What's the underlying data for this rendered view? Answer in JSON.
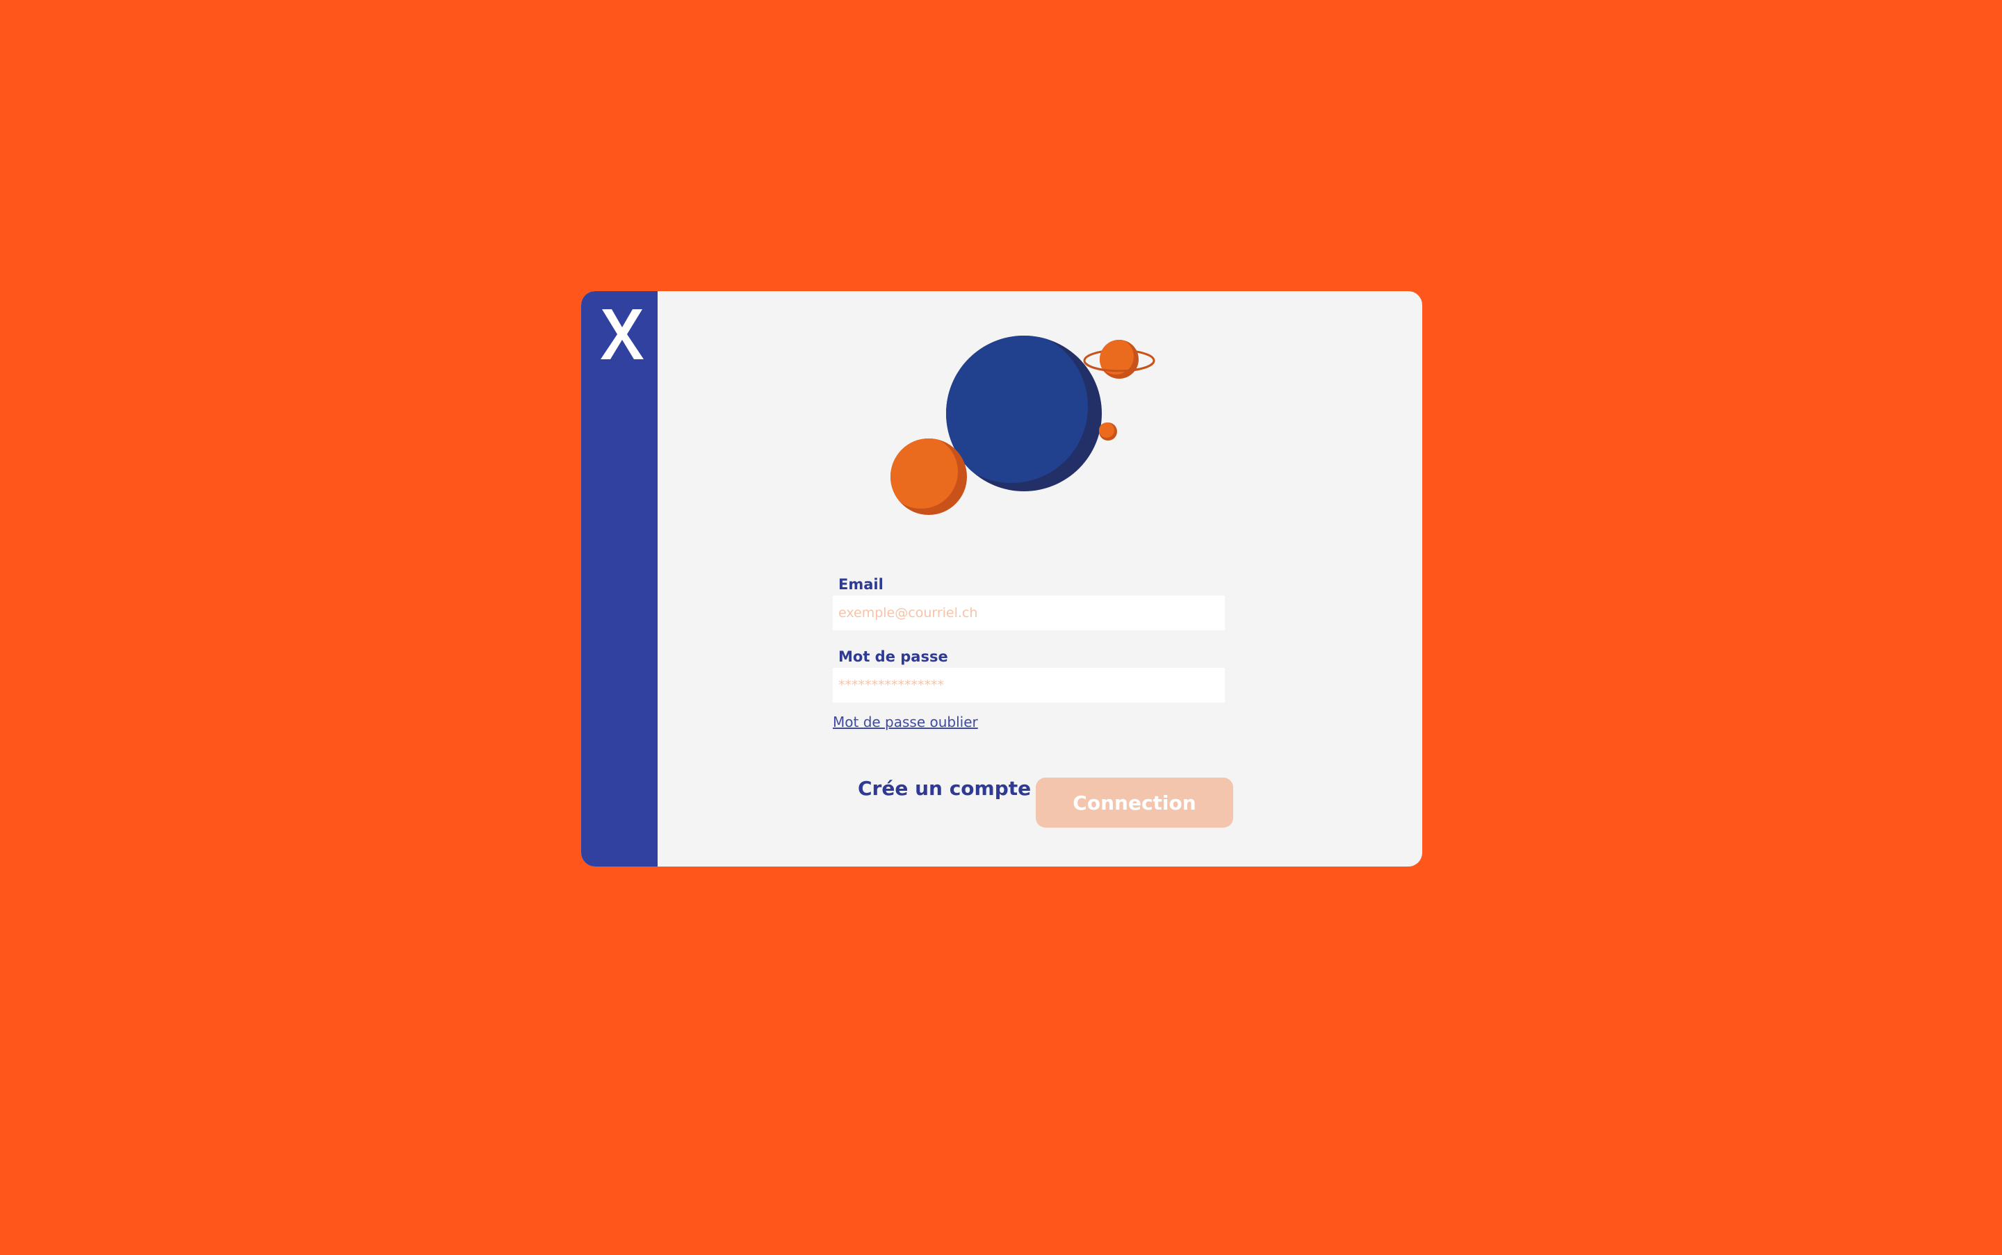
{
  "logo": {
    "text": "X",
    "icon": "x-logo-icon"
  },
  "form": {
    "email": {
      "label": "Email",
      "placeholder": "exemple@courriel.ch",
      "value": ""
    },
    "password": {
      "label": "Mot de passe",
      "placeholder": "****************",
      "value": ""
    },
    "forgot_label": "Mot de passe oublier"
  },
  "actions": {
    "create_account_label": "Crée un compte",
    "connect_label": "Connection"
  },
  "colors": {
    "background": "#FF561C",
    "sidebar": "#31419F",
    "card": "#F4F4F4",
    "primary_text": "#2E3A94",
    "button_disabled": "#F4C5AD",
    "planet_blue": "#21418F",
    "planet_orange": "#EA6A1E"
  },
  "illustration": {
    "icon": "planets-illustration-icon"
  }
}
